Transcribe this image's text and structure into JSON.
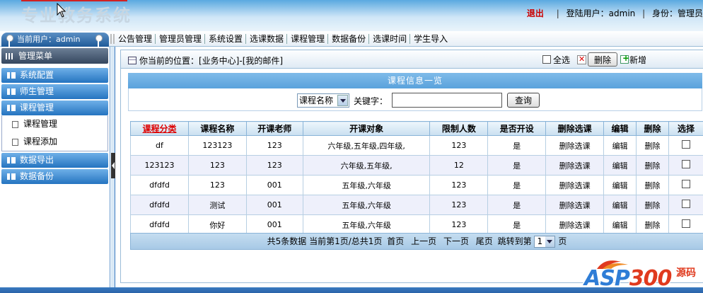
{
  "header": {
    "logo_text": "专业教务系统",
    "logout": "退出",
    "login_user_label": "登陆用户：",
    "login_user": "admin",
    "role_label": "身份：",
    "role": "管理员"
  },
  "nav": {
    "current_user_label": "当前用户：",
    "current_user": "admin",
    "items": [
      "公告管理",
      "管理员管理",
      "系统设置",
      "选课数据",
      "课程管理",
      "数据备份",
      "选课时间",
      "学生导入"
    ]
  },
  "sidebar": {
    "title": "管理菜单",
    "groups": [
      {
        "label": "系统配置"
      },
      {
        "label": "师生管理"
      },
      {
        "label": "课程管理",
        "children": [
          "课程管理",
          "课程添加"
        ]
      },
      {
        "label": "数据导出"
      },
      {
        "label": "数据备份"
      }
    ]
  },
  "toolbar": {
    "location": "你当前的位置：[业务中心]-[我的邮件]",
    "select_all": "全选",
    "delete": "删除",
    "add": "新增"
  },
  "panel": {
    "title": "课程信息一览",
    "search": {
      "category_selected": "课程名称",
      "keyword_label": "关键字：",
      "keyword_value": "",
      "query_button": "查询"
    }
  },
  "table": {
    "headers": [
      "课程分类",
      "课程名称",
      "开课老师",
      "开课对象",
      "限制人数",
      "是否开设",
      "删除选课",
      "编辑",
      "删除",
      "选择"
    ],
    "rows": [
      [
        "df",
        "123123",
        "123",
        "六年级,五年级,四年级,",
        "123",
        "是",
        "删除选课",
        "编辑",
        "删除"
      ],
      [
        "123123",
        "123",
        "123",
        "六年级,五年级,",
        "12",
        "是",
        "删除选课",
        "编辑",
        "删除"
      ],
      [
        "dfdfd",
        "123",
        "001",
        "五年级,六年级",
        "123",
        "是",
        "删除选课",
        "编辑",
        "删除"
      ],
      [
        "dfdfd",
        "测试",
        "001",
        "五年级,六年级",
        "123",
        "是",
        "删除选课",
        "编辑",
        "删除"
      ],
      [
        "dfdfd",
        "你好",
        "001",
        "五年级,六年级",
        "123",
        "是",
        "删除选课",
        "编辑",
        "删除"
      ]
    ]
  },
  "pager": {
    "summary": "共5条数据 当前第1页/总共1页",
    "first": "首页",
    "prev": "上一页",
    "next": "下一页",
    "last": "尾页",
    "jump_label": "跳转到第",
    "page_value": "1",
    "jump_suffix": "页"
  },
  "watermark": {
    "brand_a": "ASP",
    "brand_b": "300",
    "side_text": "源码",
    "colors": {
      "blue": "#2f7dd6",
      "red": "#e03a1e"
    }
  }
}
